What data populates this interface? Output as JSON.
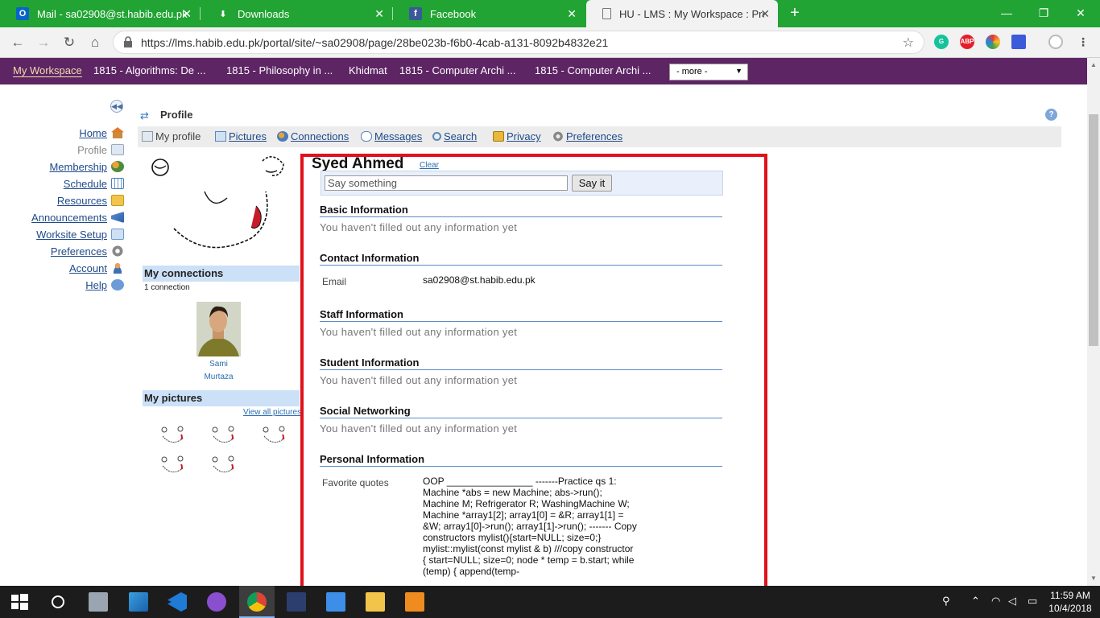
{
  "browser": {
    "tabs": [
      {
        "title": "Mail - sa02908@st.habib.edu.pk",
        "icon": "outlook-icon"
      },
      {
        "title": "Downloads",
        "icon": "download-icon"
      },
      {
        "title": "Facebook",
        "icon": "facebook-icon"
      },
      {
        "title": "HU - LMS : My Workspace : Profil",
        "icon": "page-icon"
      }
    ],
    "url": "https://lms.habib.edu.pk/portal/site/~sa02908/page/28be023b-f6b0-4cab-a131-8092b4832e21",
    "extensions": [
      "grammarly-icon",
      "adblock-icon",
      "color-icon",
      "extension-icon",
      "profile-icon"
    ],
    "extension_labels": {
      "adblock": "ABP"
    }
  },
  "sites": {
    "current": "My Workspace",
    "items": [
      "1815 - Algorithms: De ...",
      "1815 - Philosophy in ...",
      "Khidmat",
      "1815 - Computer Archi ...",
      "1815 - Computer Archi ..."
    ],
    "more": "- more -"
  },
  "tools": [
    {
      "label": "Home",
      "icon": "home-icon"
    },
    {
      "label": "Profile",
      "icon": "profile-icon"
    },
    {
      "label": "Membership",
      "icon": "membership-icon"
    },
    {
      "label": "Schedule",
      "icon": "calendar-icon"
    },
    {
      "label": "Resources",
      "icon": "folder-icon"
    },
    {
      "label": "Announcements",
      "icon": "megaphone-icon"
    },
    {
      "label": "Worksite Setup",
      "icon": "setup-icon"
    },
    {
      "label": "Preferences",
      "icon": "gear-icon"
    },
    {
      "label": "Account",
      "icon": "user-icon"
    },
    {
      "label": "Help",
      "icon": "help-icon"
    }
  ],
  "tool_title": "Profile",
  "profile_nav": {
    "my_profile": "My profile",
    "pictures": "Pictures",
    "connections": "Connections",
    "messages": "Messages",
    "search": "Search",
    "privacy": "Privacy",
    "preferences": "Preferences"
  },
  "sidebar": {
    "connections_title": "My connections",
    "connections_count": "1 connection",
    "connection_first": "Sami",
    "connection_last": "Murtaza",
    "pictures_title": "My pictures",
    "view_all": "View all pictures"
  },
  "profile": {
    "name": "Syed Ahmed",
    "clear": "Clear",
    "status_placeholder": "Say something",
    "say_button": "Say it",
    "empty_text": "You haven't filled out any information yet",
    "sections": {
      "basic": "Basic Information",
      "contact": "Contact Information",
      "staff": "Staff Information",
      "student": "Student Information",
      "social": "Social Networking",
      "personal": "Personal Information"
    },
    "email_label": "Email",
    "email_value": "sa02908@st.habib.edu.pk",
    "quotes_label": "Favorite quotes",
    "quotes_value": "OOP ________________ -------Practice qs 1: Machine *abs = new Machine; abs->run(); Machine M; Refrigerator R; WashingMachine W; Machine *array1[2]; array1[0] = &R; array1[1] = &W; array1[0]->run(); array1[1]->run(); ------- Copy constructors mylist(){start=NULL; size=0;} mylist::mylist(const mylist & b) ///copy constructor { start=NULL; size=0; node * temp = b.start; while (temp) { append(temp-"
  },
  "taskbar": {
    "time": "11:59 AM",
    "date": "10/4/2018"
  },
  "colors": {
    "tab_bar": "#21a433",
    "site_nav": "#5e2565",
    "highlight_border": "#e0121b",
    "link": "#1f4a8a",
    "section_rule": "#5a8cc6"
  }
}
